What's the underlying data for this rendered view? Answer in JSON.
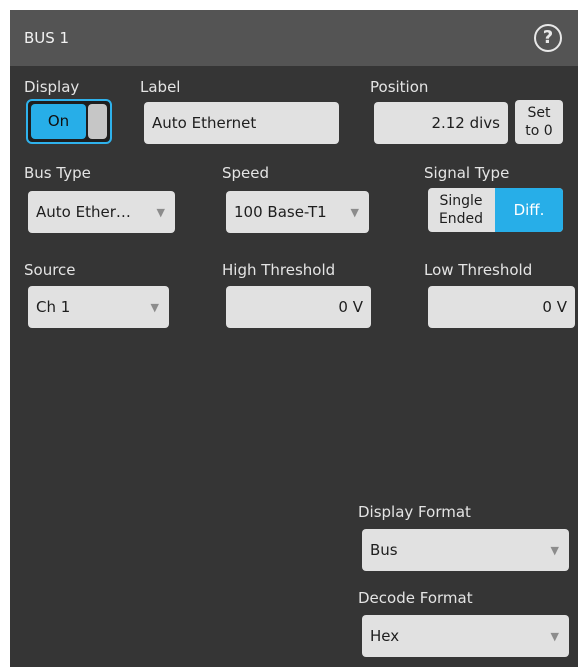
{
  "panel": {
    "title": "BUS 1",
    "help_icon": "?"
  },
  "display": {
    "label": "Display",
    "toggle_value": "On"
  },
  "label_field": {
    "label": "Label",
    "value": "Auto Ethernet"
  },
  "position": {
    "label": "Position",
    "value": "2.12 divs",
    "set_line1": "Set",
    "set_line2": "to 0"
  },
  "bus_type": {
    "label": "Bus Type",
    "value": "Auto Ether…"
  },
  "speed": {
    "label": "Speed",
    "value": "100 Base-T1"
  },
  "signal_type": {
    "label": "Signal Type",
    "option1_line1": "Single",
    "option1_line2": "Ended",
    "option2": "Diff.",
    "selected": "Diff."
  },
  "source": {
    "label": "Source",
    "value": "Ch 1"
  },
  "high_threshold": {
    "label": "High Threshold",
    "value": "0 V"
  },
  "low_threshold": {
    "label": "Low Threshold",
    "value": "0 V"
  },
  "display_format": {
    "label": "Display Format",
    "value": "Bus"
  },
  "decode_format": {
    "label": "Decode Format",
    "value": "Hex"
  },
  "colors": {
    "accent": "#27aee8",
    "panel_bg": "#353535",
    "header_bg": "#545454",
    "field_bg": "#e1e1e1"
  },
  "icons": {
    "help": "help-icon",
    "dropdown": "chevron-down-icon"
  }
}
